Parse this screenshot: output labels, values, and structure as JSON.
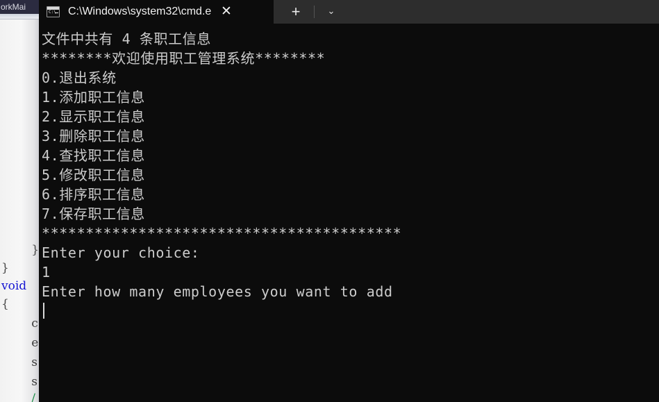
{
  "background_editor": {
    "window_title": "orkMai",
    "code_lines": [
      {
        "text": "        }",
        "kind": "brace"
      },
      {
        "text": "}",
        "kind": "brace"
      },
      {
        "text": "void ",
        "kind": "keyword"
      },
      {
        "text": "{",
        "kind": "brace"
      },
      {
        "text": "        c",
        "kind": "identifier"
      },
      {
        "text": "        e",
        "kind": "identifier"
      },
      {
        "text": "        s",
        "kind": "identifier"
      },
      {
        "text": "        s",
        "kind": "identifier"
      },
      {
        "text": "        /",
        "kind": "comment"
      }
    ]
  },
  "titlebar": {
    "tab_icon_name": "cmd-console-icon",
    "tab_icon_glyph": "C:\\",
    "tab_title": "C:\\Windows\\system32\\cmd.e",
    "close_label": "✕",
    "new_tab_label": "+",
    "dropdown_label": "⌄",
    "colors": {
      "titlebar_bg": "#2d2d2d",
      "active_tab_bg": "#0c0c0c",
      "text": "#f1f1f1"
    }
  },
  "console": {
    "bg": "#0c0c0c",
    "fg": "#cccccc",
    "lines": [
      "文件中共有 4 条职工信息",
      "********欢迎使用职工管理系统********",
      "0.退出系统",
      "1.添加职工信息",
      "2.显示职工信息",
      "3.删除职工信息",
      "4.查找职工信息",
      "5.修改职工信息",
      "6.排序职工信息",
      "7.保存职工信息",
      "*****************************************",
      "Enter your choice:",
      "1",
      "Enter how many employees you want to add"
    ],
    "record_count": "4",
    "selected_choice": "1",
    "cursor_visible": true
  }
}
